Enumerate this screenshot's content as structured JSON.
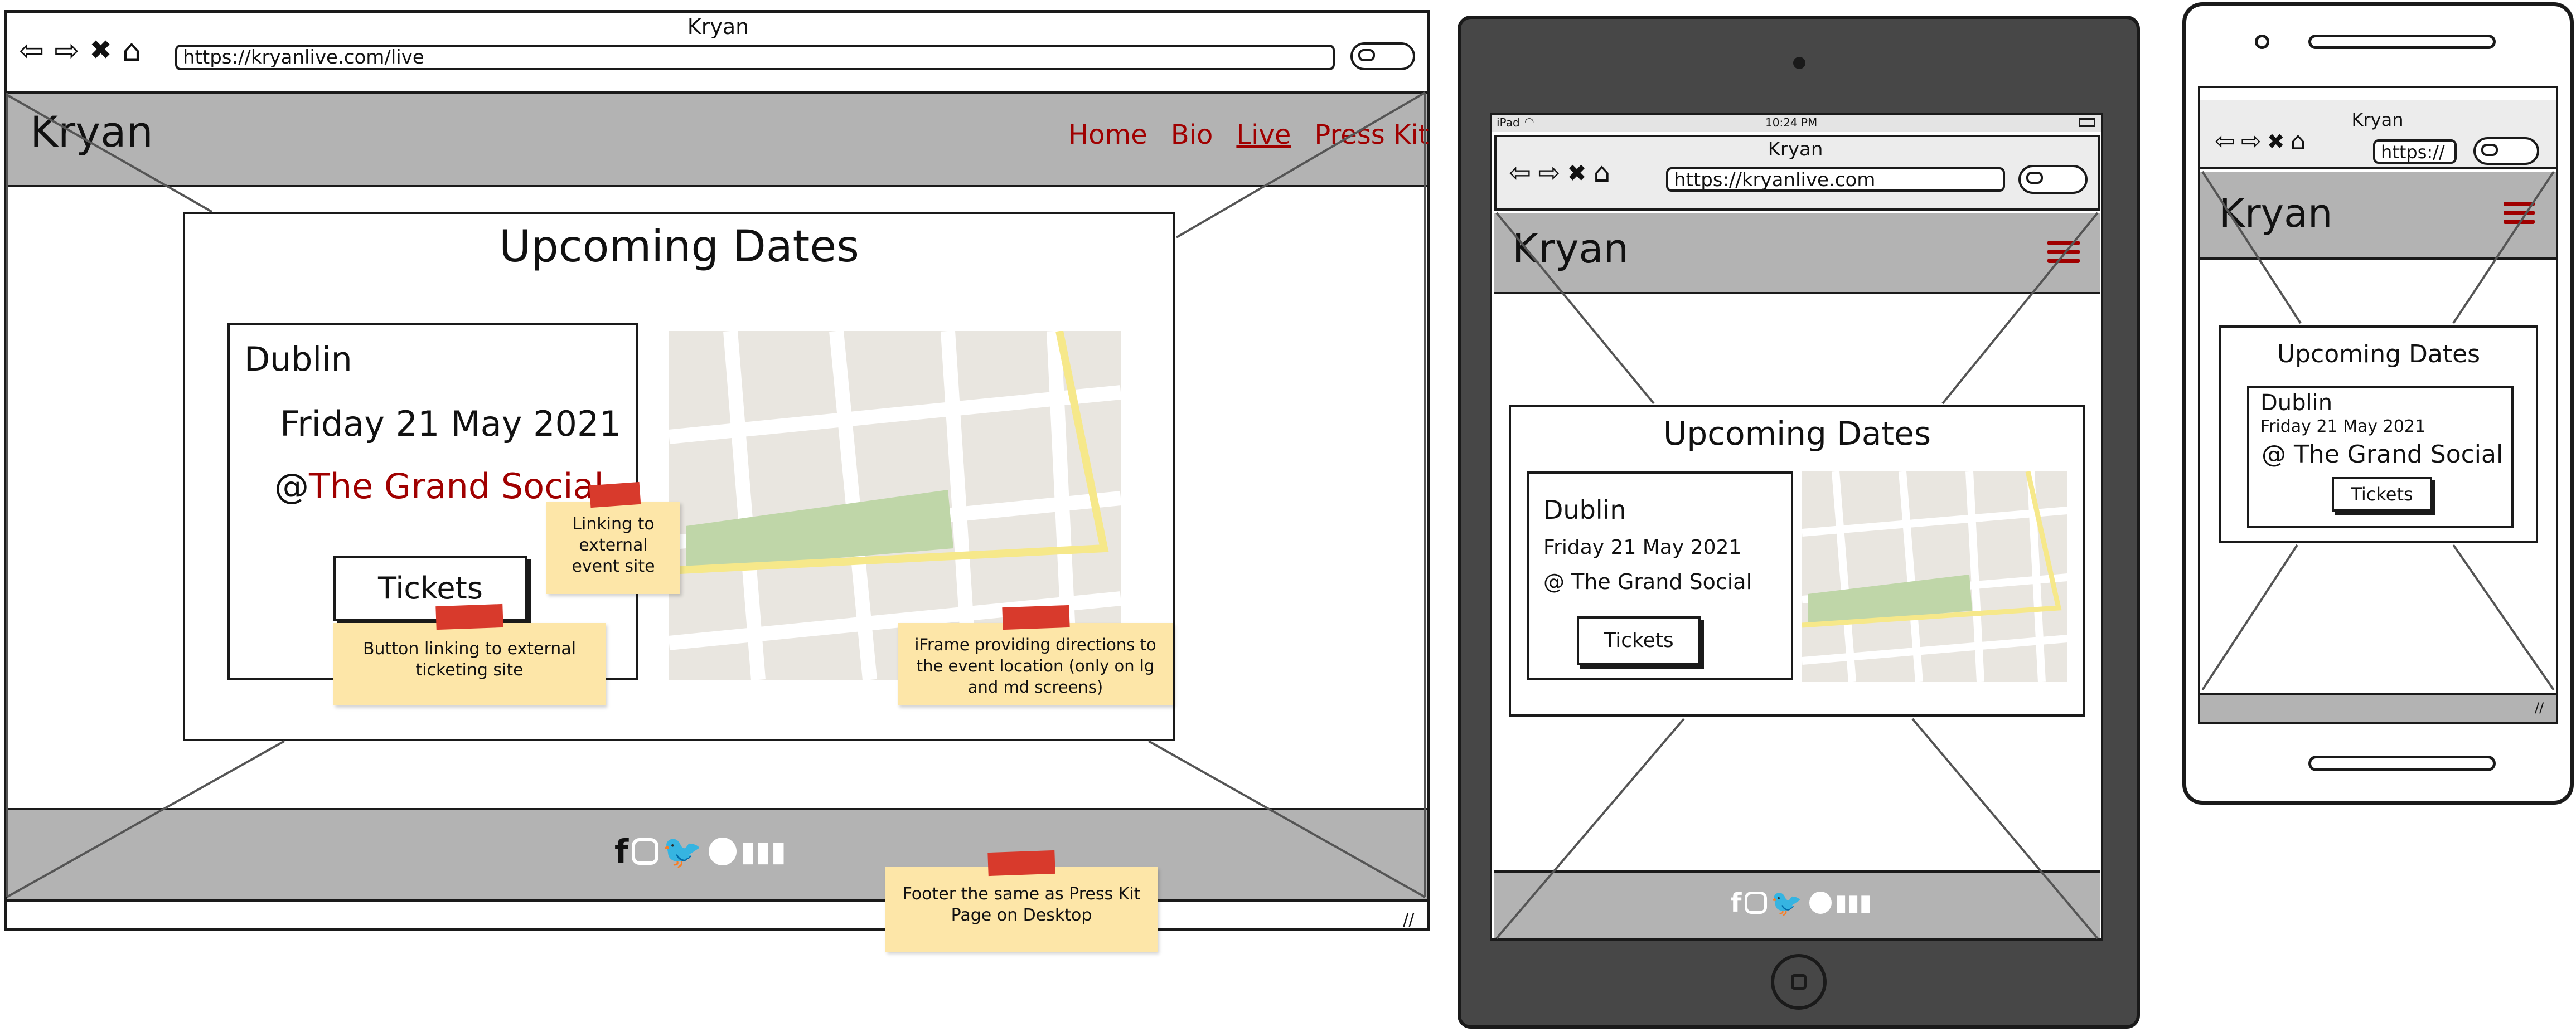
{
  "desktop": {
    "browser_title": "Kryan",
    "url": "https://kryanlive.com/live",
    "brand": "Kryan",
    "nav": [
      "Home",
      "Bio",
      "Live",
      "Press Kit"
    ],
    "section_title": "Upcoming Dates",
    "event": {
      "city": "Dublin",
      "date": "Friday 21 May 2021",
      "at": "@",
      "venue": "The Grand Social",
      "button": "Tickets"
    },
    "notes": {
      "venue_link": "Linking to external event site",
      "tickets": "Button linking to external ticketing site",
      "iframe": "iFrame providing directions to the event location (only on lg and md screens)",
      "footer": "Footer the same as Press Kit Page on Desktop"
    },
    "footer_icons": [
      "facebook-icon",
      "instagram-icon",
      "twitter-icon",
      "apple-icon",
      "spotify-icon",
      "deezer-icon"
    ]
  },
  "tablet": {
    "device_label": "iPad",
    "time": "10:24 PM",
    "browser_title": "Kryan",
    "url": "https://kryanlive.com",
    "brand": "Kryan",
    "section_title": "Upcoming Dates",
    "event": {
      "city": "Dublin",
      "date": "Friday 21 May 2021",
      "venue": "@ The Grand Social",
      "button": "Tickets"
    },
    "footer_icons": [
      "facebook-icon",
      "instagram-icon",
      "twitter-icon",
      "apple-icon",
      "spotify-icon",
      "deezer-icon"
    ]
  },
  "phone": {
    "browser_title": "Kryan",
    "url": "https://",
    "brand": "Kryan",
    "section_title": "Upcoming Dates",
    "event": {
      "city": "Dublin",
      "date": "Friday 21 May 2021",
      "venue": "@ The Grand Social",
      "button": "Tickets"
    }
  },
  "colors": {
    "accent": "#a00000",
    "chrome_gray": "#b3b3b3",
    "device_body": "#474747",
    "note": "#fde6a8",
    "tape": "#d83a2c",
    "map_bg": "#e9e6e0",
    "map_park": "#bfd6a8",
    "map_road": "#f6e88a"
  }
}
